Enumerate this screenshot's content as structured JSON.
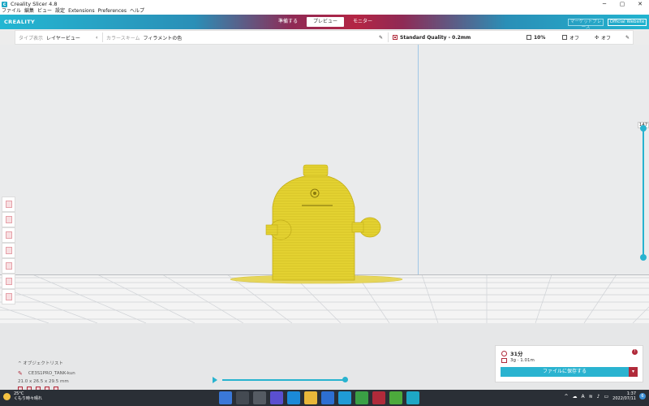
{
  "window": {
    "title": "Creality Slicer 4.8",
    "controls": [
      "─",
      "▢",
      "✕"
    ]
  },
  "menu": [
    "ファイル",
    "編集",
    "ビュー",
    "設定",
    "Extensions",
    "Preferences",
    "ヘルプ"
  ],
  "header": {
    "logo": "CREALITY",
    "stages": [
      {
        "label": "準備する",
        "active": false
      },
      {
        "label": "プレビュー",
        "active": true
      },
      {
        "label": "モニター",
        "active": false
      }
    ],
    "marketplace_label": "マーケットプレース",
    "official_website_label": "Official Website"
  },
  "toolbar": {
    "view_type_label": "タイプ表示",
    "view_type_value": "レイヤービュー",
    "color_scheme_label": "カラースキーム",
    "color_scheme_value": "フィラメントの色",
    "quality": "Standard Quality - 0.2mm",
    "infill": "10%",
    "support": "オフ",
    "adhesion": "オフ"
  },
  "layer_slider": {
    "top_value": "147"
  },
  "object_list": {
    "toggle_label": "オブジェクトリスト",
    "object_name": "CE3S1PRO_TANK-kun",
    "dimensions": "21.0 x 26.5 x 29.5 mm"
  },
  "simulation": {
    "progress": 1.0
  },
  "print_info": {
    "time": "31分",
    "material": "3g · 1.01m",
    "save_label": "ファイルに保存する",
    "dropdown_glyph": "▾"
  },
  "taskbar": {
    "temperature": "25°C",
    "weather": "くもり時々晴れ",
    "time": "1:37",
    "date": "2022/07/11",
    "tray_caret": "^",
    "ime": "A",
    "notifications": "6"
  },
  "colors": {
    "accent": "#28b3cf",
    "brand_red": "#b02a3a",
    "model": "#e6d230"
  }
}
